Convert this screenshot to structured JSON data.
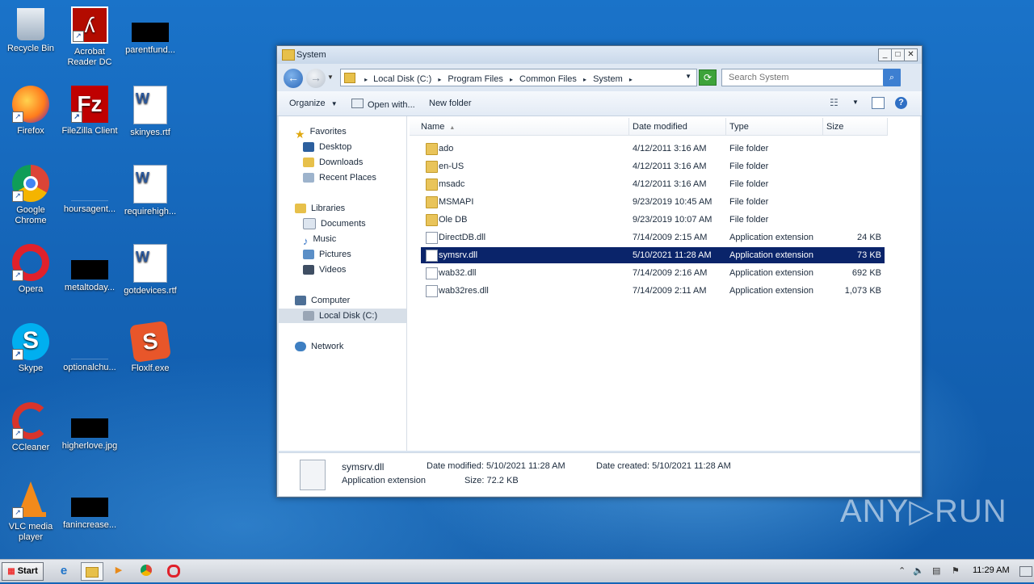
{
  "desktop": {
    "icons": [
      {
        "label": "Recycle Bin"
      },
      {
        "label": "Acrobat Reader DC"
      },
      {
        "label": "parentfund..."
      },
      {
        "label": "Firefox"
      },
      {
        "label": "FileZilla Client"
      },
      {
        "label": "skinyes.rtf"
      },
      {
        "label": "Google Chrome"
      },
      {
        "label": "hoursagent..."
      },
      {
        "label": "requirehigh..."
      },
      {
        "label": "Opera"
      },
      {
        "label": "metaltoday..."
      },
      {
        "label": "gotdevices.rtf"
      },
      {
        "label": "Skype"
      },
      {
        "label": "optionalchu..."
      },
      {
        "label": "Floxlf.exe"
      },
      {
        "label": "CCleaner"
      },
      {
        "label": "higherlove.jpg"
      },
      {
        "label": "VLC media player"
      },
      {
        "label": "fanincrease..."
      }
    ]
  },
  "window": {
    "title": "System",
    "buttons": {
      "minimize": "_",
      "maximize": "□",
      "close": "✕"
    },
    "address": {
      "crumbs": [
        "Local Disk (C:)",
        "Program Files",
        "Common Files",
        "System"
      ],
      "separator": "▸"
    },
    "search_placeholder": "Search System",
    "toolbar": {
      "organize": "Organize",
      "open_with": "Open with...",
      "new_folder": "New folder"
    },
    "nav": {
      "favorites": "Favorites",
      "desktop": "Desktop",
      "downloads": "Downloads",
      "recent": "Recent Places",
      "libraries": "Libraries",
      "documents": "Documents",
      "music": "Music",
      "pictures": "Pictures",
      "videos": "Videos",
      "computer": "Computer",
      "localdisk": "Local Disk (C:)",
      "network": "Network"
    },
    "columns": {
      "name": "Name",
      "date": "Date modified",
      "type": "Type",
      "size": "Size"
    },
    "files": [
      {
        "name": "ado",
        "date": "4/12/2011 3:16 AM",
        "type": "File folder",
        "size": ""
      },
      {
        "name": "en-US",
        "date": "4/12/2011 3:16 AM",
        "type": "File folder",
        "size": ""
      },
      {
        "name": "msadc",
        "date": "4/12/2011 3:16 AM",
        "type": "File folder",
        "size": ""
      },
      {
        "name": "MSMAPI",
        "date": "9/23/2019 10:45 AM",
        "type": "File folder",
        "size": ""
      },
      {
        "name": "Ole DB",
        "date": "9/23/2019 10:07 AM",
        "type": "File folder",
        "size": ""
      },
      {
        "name": "DirectDB.dll",
        "date": "7/14/2009 2:15 AM",
        "type": "Application extension",
        "size": "24 KB"
      },
      {
        "name": "symsrv.dll",
        "date": "5/10/2021 11:28 AM",
        "type": "Application extension",
        "size": "73 KB"
      },
      {
        "name": "wab32.dll",
        "date": "7/14/2009 2:16 AM",
        "type": "Application extension",
        "size": "692 KB"
      },
      {
        "name": "wab32res.dll",
        "date": "7/14/2009 2:11 AM",
        "type": "Application extension",
        "size": "1,073 KB"
      }
    ],
    "details": {
      "filename": "symsrv.dll",
      "filetype": "Application extension",
      "modified": "Date modified: 5/10/2021 11:28 AM",
      "created": "Date created: 5/10/2021 11:28 AM",
      "size": "Size: 72.2 KB"
    }
  },
  "taskbar": {
    "start": "Start",
    "clock": "11:29 AM"
  },
  "watermark": "ANY▷RUN"
}
